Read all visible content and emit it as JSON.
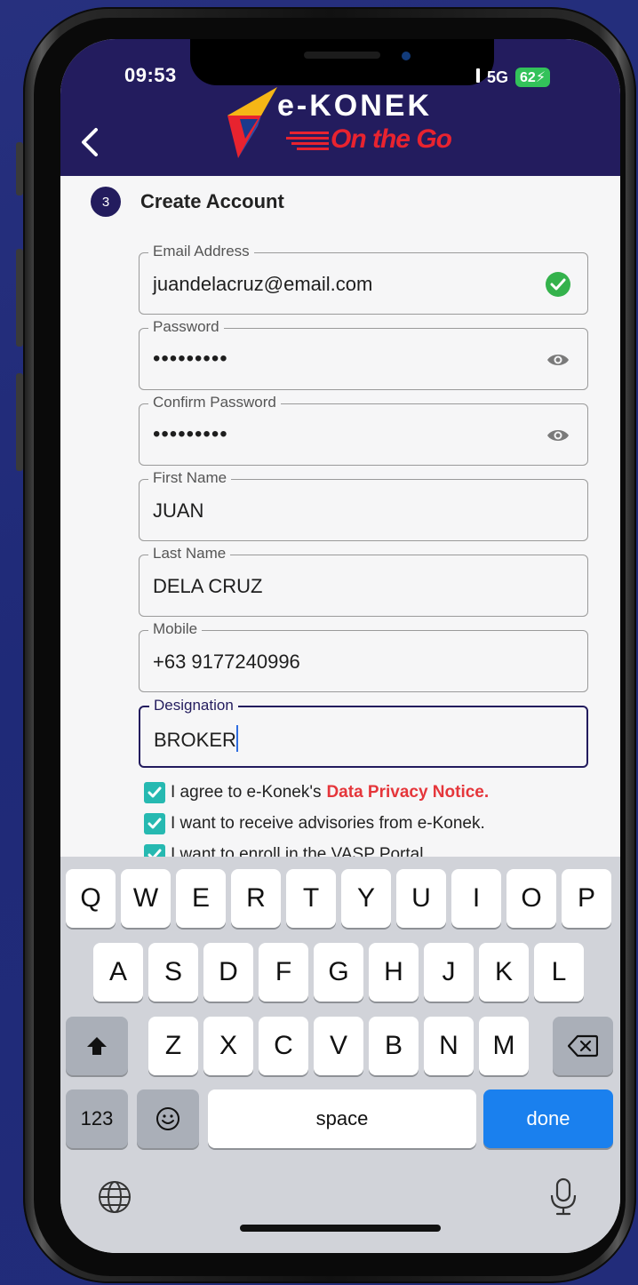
{
  "status_bar": {
    "time": "09:53",
    "network": "5G",
    "battery": "62"
  },
  "header": {
    "logo_main": "e-KONEK",
    "logo_sub": "On the Go",
    "colors": {
      "header_bg": "#231c5e",
      "accent_red": "#e8232f"
    }
  },
  "step": {
    "number": "3",
    "title": "Create Account"
  },
  "form": {
    "email": {
      "label": "Email Address",
      "value": "juandelacruz@email.com"
    },
    "password": {
      "label": "Password",
      "value": "•••••••••"
    },
    "confirm_password": {
      "label": "Confirm Password",
      "value": "•••••••••"
    },
    "first_name": {
      "label": "First Name",
      "value": "JUAN"
    },
    "last_name": {
      "label": "Last Name",
      "value": "DELA CRUZ"
    },
    "mobile": {
      "label": "Mobile",
      "value": "+63 9177240996"
    },
    "designation": {
      "label": "Designation",
      "value": "BROKER"
    }
  },
  "checkboxes": {
    "privacy_prefix": "I agree to e-Konek's",
    "privacy_link": "Data Privacy Notice.",
    "advisories": "I want to receive advisories from e-Konek.",
    "vasp": "I want to enroll in the VASP Portal"
  },
  "keyboard": {
    "row1": [
      "Q",
      "W",
      "E",
      "R",
      "T",
      "Y",
      "U",
      "I",
      "O",
      "P"
    ],
    "row2": [
      "A",
      "S",
      "D",
      "F",
      "G",
      "H",
      "J",
      "K",
      "L"
    ],
    "row3": [
      "Z",
      "X",
      "C",
      "V",
      "B",
      "N",
      "M"
    ],
    "numbers_key": "123",
    "space_key": "space",
    "done_key": "done"
  }
}
